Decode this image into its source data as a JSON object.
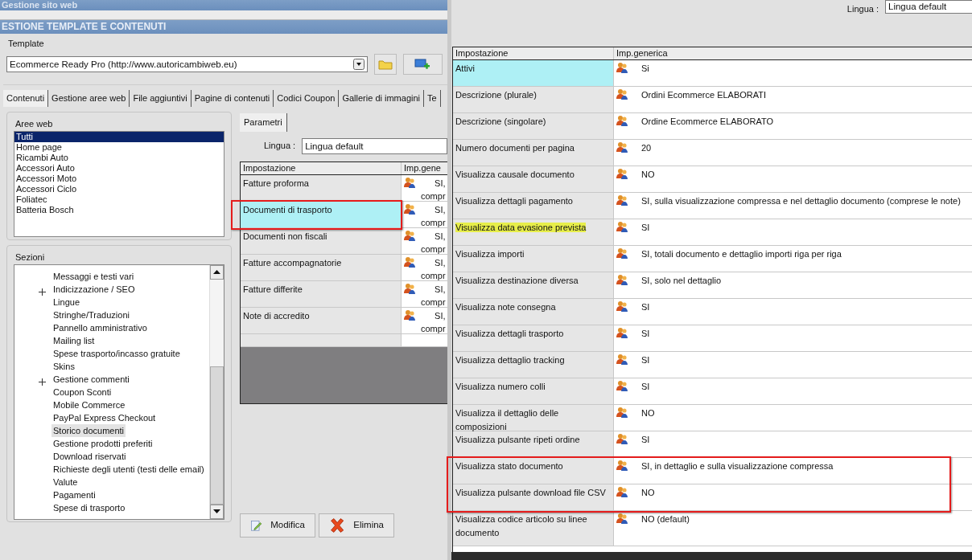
{
  "background_window": {
    "title": "Gestione sito web"
  },
  "window": {
    "title": "ESTIONE TEMPLATE E CONTENUTI",
    "template": {
      "label": "Template",
      "value": "Ecommerce Ready Pro (http://www.autoricambiweb.eu)"
    },
    "tabs": [
      {
        "label": "Contenuti",
        "selected": true
      },
      {
        "label": "Gestione aree web",
        "selected": false
      },
      {
        "label": "File aggiuntivi",
        "selected": false
      },
      {
        "label": "Pagine di contenuti",
        "selected": false
      },
      {
        "label": "Codici Coupon",
        "selected": false
      },
      {
        "label": "Gallerie di immagini",
        "selected": false
      },
      {
        "label": "Te",
        "selected": false
      }
    ],
    "aree_web": {
      "label": "Aree web",
      "items": [
        {
          "label": "Tutti",
          "selected": true
        },
        {
          "label": "Home page",
          "selected": false
        },
        {
          "label": "Ricambi Auto",
          "selected": false
        },
        {
          "label": "Accessori Auto",
          "selected": false
        },
        {
          "label": "Accessori Moto",
          "selected": false
        },
        {
          "label": "Accessori Ciclo",
          "selected": false
        },
        {
          "label": "Foliatec",
          "selected": false
        },
        {
          "label": "Batteria Bosch",
          "selected": false
        }
      ]
    },
    "sezioni": {
      "label": "Sezioni",
      "items": [
        {
          "label": "Messaggi e testi vari",
          "collapsed": false,
          "selected": false
        },
        {
          "label": "Indicizzazione / SEO",
          "collapsed": true,
          "selected": false
        },
        {
          "label": "Lingue",
          "collapsed": false,
          "selected": false
        },
        {
          "label": "Stringhe/Traduzioni",
          "collapsed": false,
          "selected": false
        },
        {
          "label": "Pannello amministrativo",
          "collapsed": false,
          "selected": false
        },
        {
          "label": "Mailing list",
          "collapsed": false,
          "selected": false
        },
        {
          "label": "Spese trasporto/incasso gratuite",
          "collapsed": false,
          "selected": false
        },
        {
          "label": "Skins",
          "collapsed": false,
          "selected": false
        },
        {
          "label": "Gestione commenti",
          "collapsed": true,
          "selected": false
        },
        {
          "label": "Coupon Sconti",
          "collapsed": false,
          "selected": false
        },
        {
          "label": "Mobile Commerce",
          "collapsed": false,
          "selected": false
        },
        {
          "label": "PayPal Express Checkout",
          "collapsed": false,
          "selected": false
        },
        {
          "label": "Storico documenti",
          "collapsed": false,
          "selected": true
        },
        {
          "label": "Gestione prodotti preferiti",
          "collapsed": false,
          "selected": false
        },
        {
          "label": "Download riservati",
          "collapsed": false,
          "selected": false
        },
        {
          "label": "Richieste degli utenti (testi delle email)",
          "collapsed": false,
          "selected": false
        },
        {
          "label": "Valute",
          "collapsed": false,
          "selected": false
        },
        {
          "label": "Pagamenti",
          "collapsed": false,
          "selected": false
        },
        {
          "label": "Spese di trasporto",
          "collapsed": false,
          "selected": false
        }
      ]
    },
    "parametri": {
      "tab": "Parametri",
      "lingua_label": "Lingua :",
      "lingua_value": "Lingua default",
      "columns": [
        "Impostazione",
        "Imp.gene"
      ],
      "rows": [
        {
          "setting": "Fatture proforma",
          "value": [
            "SI,",
            "compr"
          ],
          "selected": false,
          "outlined": false
        },
        {
          "setting": "Documenti di trasporto",
          "value": [
            "SI,",
            "compr"
          ],
          "selected": true,
          "outlined": true
        },
        {
          "setting": "Documenti non fiscali",
          "value": [
            "SI,",
            "compr"
          ],
          "selected": false,
          "outlined": false
        },
        {
          "setting": "Fatture accompagnatorie",
          "value": [
            "SI,",
            "compr"
          ],
          "selected": false,
          "outlined": false
        },
        {
          "setting": "Fatture differite",
          "value": [
            "SI,",
            "compr"
          ],
          "selected": false,
          "outlined": false
        },
        {
          "setting": "Note di accredito",
          "value": [
            "SI,",
            "compr"
          ],
          "selected": false,
          "outlined": false
        }
      ]
    },
    "buttons": [
      {
        "label": "Modifica",
        "kind": "edit"
      },
      {
        "label": "Elimina",
        "kind": "delete"
      }
    ]
  },
  "detail_window": {
    "lingua_label": "Lingua :",
    "lingua_value": "Lingua default",
    "columns": [
      "Impostazione",
      "Imp.generica"
    ],
    "rows": [
      {
        "setting": "Attivi",
        "value": "Si",
        "selected": true,
        "outlined": false,
        "highlighted": false
      },
      {
        "setting": "Descrizione (plurale)",
        "value": "Ordini Ecommerce ELABORATI",
        "selected": false,
        "outlined": false,
        "highlighted": false
      },
      {
        "setting": "Descrizione (singolare)",
        "value": "Ordine Ecommerce ELABORATO",
        "selected": false,
        "outlined": false,
        "highlighted": false
      },
      {
        "setting": "Numero documenti per pagina",
        "value": "20",
        "selected": false,
        "outlined": false,
        "highlighted": false
      },
      {
        "setting": "Visualizza causale documento",
        "value": "NO",
        "selected": false,
        "outlined": false,
        "highlighted": false
      },
      {
        "setting": "Visualizza dettagli pagamento",
        "value": "SI, sulla visualizzazione compressa e nel dettaglio documento (comprese le note)",
        "selected": false,
        "outlined": false,
        "highlighted": false
      },
      {
        "setting": "Visualizza data evasione prevista",
        "value": "SI",
        "selected": false,
        "outlined": false,
        "highlighted": true
      },
      {
        "setting": "Visualizza importi",
        "value": "SI, totali documento e dettaglio importi riga per riga",
        "selected": false,
        "outlined": false,
        "highlighted": false
      },
      {
        "setting": "Visualizza destinazione diversa",
        "value": "SI, solo nel dettaglio",
        "selected": false,
        "outlined": false,
        "highlighted": false
      },
      {
        "setting": "Visualizza note consegna",
        "value": "SI",
        "selected": false,
        "outlined": false,
        "highlighted": false
      },
      {
        "setting": "Visualizza dettagli trasporto",
        "value": "SI",
        "selected": false,
        "outlined": false,
        "highlighted": false
      },
      {
        "setting": "Visualizza dettaglio tracking",
        "value": "SI",
        "selected": false,
        "outlined": false,
        "highlighted": false
      },
      {
        "setting": "Visualizza numero colli",
        "value": "SI",
        "selected": false,
        "outlined": false,
        "highlighted": false
      },
      {
        "setting": "Visualizza il dettaglio delle composizioni",
        "value": "NO",
        "selected": false,
        "outlined": false,
        "highlighted": false
      },
      {
        "setting": "Visualizza pulsante ripeti ordine",
        "value": "SI",
        "selected": false,
        "outlined": false,
        "highlighted": false
      },
      {
        "setting": "Visualizza stato documento",
        "value": "SI, in dettaglio e sulla visualizzazione compressa",
        "selected": false,
        "outlined": true,
        "highlighted": false
      },
      {
        "setting": "Visualizza pulsante download file CSV",
        "value": "NO",
        "selected": false,
        "outlined": true,
        "highlighted": false
      },
      {
        "setting": "Visualizza codice articolo su linee documento",
        "value": "NO (default)",
        "selected": false,
        "outlined": false,
        "highlighted": false
      }
    ]
  }
}
